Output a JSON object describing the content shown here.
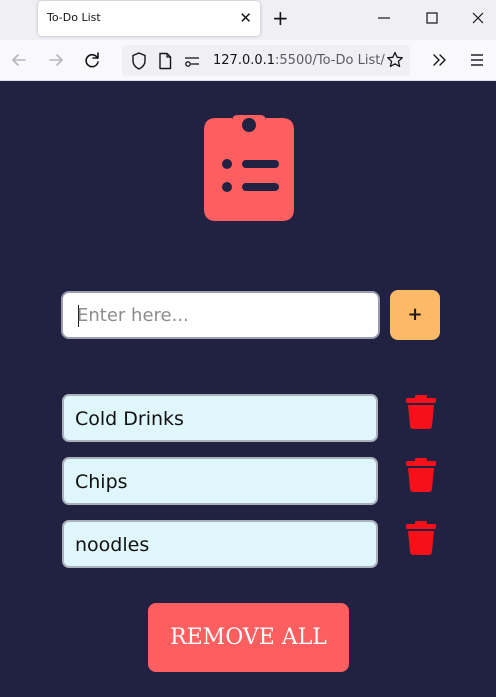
{
  "browser": {
    "tab_title": "To-Do List",
    "tab_close_icon": "close-icon",
    "new_tab_icon": "plus-icon",
    "url_host": "127.0.0.1",
    "url_rest": ":5500/To-Do List/",
    "icons": [
      "back-icon",
      "forward-icon",
      "reload-icon",
      "shield-icon",
      "page-icon",
      "site-permissions-icon",
      "bookmark-star-icon",
      "overflow-chevrons-icon",
      "menu-icon",
      "minimize-icon",
      "maximize-icon",
      "window-close-icon"
    ]
  },
  "app": {
    "logo_icon": "clipboard-list-icon",
    "input_placeholder": "Enter here...",
    "add_label": "+",
    "items": [
      {
        "label": "Cold Drinks"
      },
      {
        "label": "Chips"
      },
      {
        "label": "noodles"
      }
    ],
    "delete_icon": "trash-icon",
    "remove_all_label": "REMOVE ALL",
    "colors": {
      "background": "#212142",
      "accent": "#fd5e60",
      "add_button": "#fcb968",
      "item_background": "#dff6fb",
      "trash": "#f5101a"
    }
  }
}
